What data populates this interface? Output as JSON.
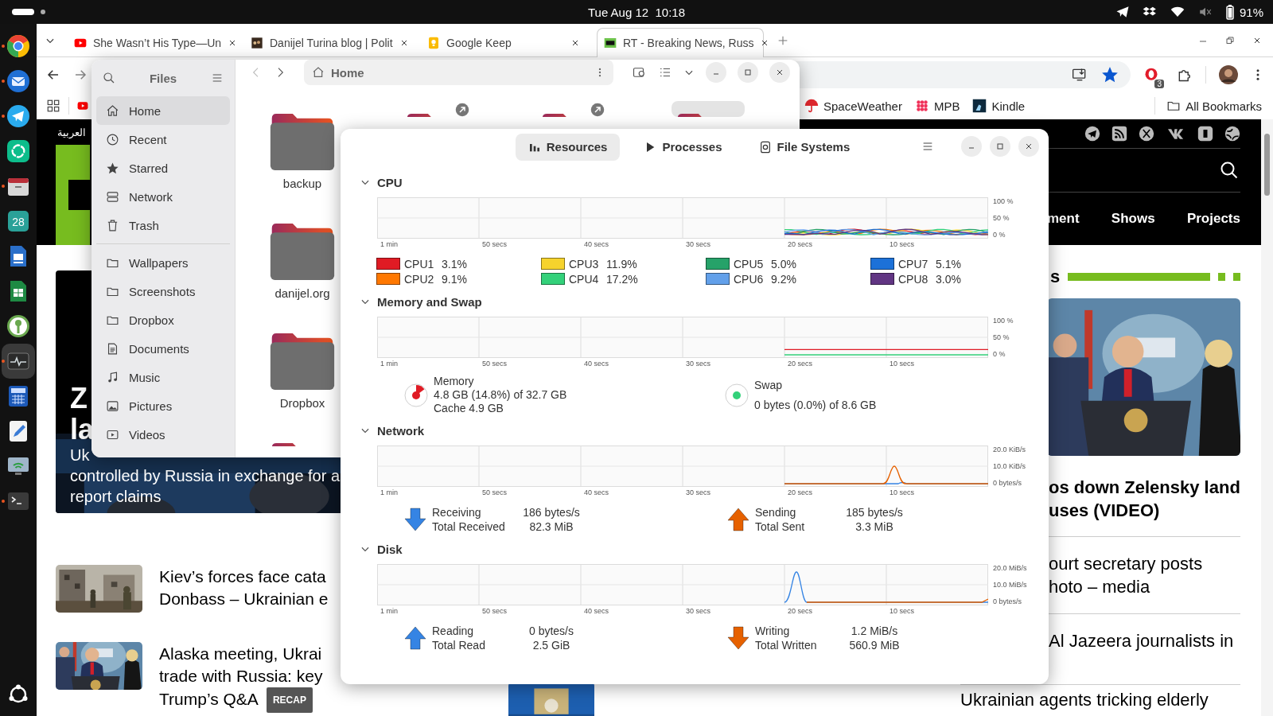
{
  "top_bar": {
    "clock": "Tue Aug 12  10:18",
    "battery": "91%"
  },
  "dock": [
    {
      "kind": "chrome",
      "running": true,
      "selected": false
    },
    {
      "kind": "thunderbird",
      "running": true,
      "selected": false
    },
    {
      "kind": "telegram",
      "running": true,
      "selected": false
    },
    {
      "kind": "element",
      "running": false,
      "selected": false
    },
    {
      "kind": "files",
      "running": true,
      "selected": false
    },
    {
      "kind": "calendar",
      "label": "28",
      "running": false,
      "selected": false
    },
    {
      "kind": "writer",
      "running": false,
      "selected": false
    },
    {
      "kind": "spreadsheet",
      "running": false,
      "selected": false
    },
    {
      "kind": "keepass",
      "running": false,
      "selected": false
    },
    {
      "kind": "monitor",
      "running": true,
      "selected": true
    },
    {
      "kind": "calculator",
      "running": false,
      "selected": false
    },
    {
      "kind": "editor",
      "running": false,
      "selected": false
    },
    {
      "kind": "remote",
      "running": false,
      "selected": false
    },
    {
      "kind": "terminal",
      "running": true,
      "selected": false
    }
  ],
  "browser": {
    "tabs": [
      {
        "title": "She Wasn’t His Type—Un",
        "selected": false
      },
      {
        "title": "Danijel Turina blog | Polit",
        "selected": false
      },
      {
        "title": "Google Keep",
        "selected": false
      },
      {
        "title": "RT - Breaking News, Russ",
        "selected": true
      }
    ],
    "bookmarked": true,
    "extension_badge": "3",
    "bookmarks": [
      {
        "label": "SpaceWeather"
      },
      {
        "label": "MPB"
      },
      {
        "label": "Kindle"
      }
    ],
    "all_bookmarks": "All Bookmarks",
    "page": {
      "language": "العربية",
      "nav": [
        "ment",
        "Shows",
        "Projects"
      ],
      "hero": {
        "title_lines": [
          "Z",
          "la"
        ],
        "text_lines": [
          "Uk",
          "controlled by Russia in exchange for a",
          "report claims"
        ]
      },
      "headlines": [
        {
          "lines": [
            "Kiev’s forces face cata",
            "Donbass – Ukrainian e"
          ]
        },
        {
          "lines": [
            "Alaska meeting, Ukrai",
            "trade with Russia: key",
            "Trump’s Q&A"
          ],
          "badge": "RECAP"
        }
      ],
      "section_title": "s",
      "lead": [
        "os down Zelensky land",
        "uses (VIDEO)"
      ],
      "stories": [
        {
          "lines": [
            "ourt secretary posts",
            "hoto – media"
          ]
        },
        {
          "lines": [
            "Al Jazeera journalists in"
          ]
        },
        {
          "lines": [
            "Ukrainian agents tricking elderly"
          ]
        }
      ]
    }
  },
  "files": {
    "title": "Files",
    "places": [
      {
        "label": "Home",
        "selected": true
      },
      {
        "label": "Recent",
        "selected": false
      },
      {
        "label": "Starred",
        "selected": false
      },
      {
        "label": "Network",
        "selected": false
      },
      {
        "label": "Trash",
        "selected": false
      }
    ],
    "bookmarks": [
      {
        "label": "Wallpapers",
        "selected": false
      },
      {
        "label": "Screenshots",
        "selected": false
      },
      {
        "label": "Dropbox",
        "selected": false
      },
      {
        "label": "Documents",
        "selected": false
      },
      {
        "label": "Music",
        "selected": false
      },
      {
        "label": "Pictures",
        "selected": false
      },
      {
        "label": "Videos",
        "selected": false
      }
    ],
    "path": "Home",
    "folders": [
      {
        "name": "backup",
        "selected": false,
        "shared": false
      },
      {
        "selected": false,
        "shared": true
      },
      {
        "selected": false,
        "shared": true
      },
      {
        "selected": true,
        "shared": false
      },
      {
        "name": "danijel.org",
        "selected": false,
        "shared": false
      },
      {
        "name": "Dropbox",
        "selected": false,
        "shared": false
      },
      {
        "selected": false,
        "shared": false
      }
    ]
  },
  "system_monitor": {
    "tabs": [
      {
        "label": "Resources",
        "selected": true
      },
      {
        "label": "Processes",
        "selected": false
      },
      {
        "label": "File Systems",
        "selected": false
      }
    ],
    "sections": [
      {
        "kind": "cpu",
        "title": "CPU",
        "expanded": true,
        "x_labels": [
          "1 min",
          "50 secs",
          "40 secs",
          "30 secs",
          "20 secs",
          "10 secs"
        ],
        "y_labels": [
          "100 %",
          "50 %",
          "0 %"
        ],
        "legend": [
          {
            "name": "CPU1",
            "reading": "3.1%",
            "color": "#e01b24"
          },
          {
            "name": "CPU2",
            "reading": "9.1%",
            "color": "#ff7800"
          },
          {
            "name": "CPU3",
            "reading": "11.9%",
            "color": "#f6d32d"
          },
          {
            "name": "CPU4",
            "reading": "17.2%",
            "color": "#33d17a"
          },
          {
            "name": "CPU5",
            "reading": "5.0%",
            "color": "#26a269"
          },
          {
            "name": "CPU6",
            "reading": "9.2%",
            "color": "#62a0ea"
          },
          {
            "name": "CPU7",
            "reading": "5.1%",
            "color": "#1c71d8"
          },
          {
            "name": "CPU8",
            "reading": "3.0%",
            "color": "#613583"
          }
        ]
      },
      {
        "kind": "memory",
        "title": "Memory and Swap",
        "expanded": true,
        "x_labels": [
          "1 min",
          "50 secs",
          "40 secs",
          "30 secs",
          "20 secs",
          "10 secs"
        ],
        "y_labels": [
          "100 %",
          "50 %",
          "0 %"
        ],
        "gauges": [
          {
            "label": "Memory",
            "lines": [
              "4.8 GB (14.8%) of 32.7 GB",
              "Cache 4.9 GB"
            ],
            "level": 0.15,
            "color": "#e01b24"
          },
          {
            "label": "Swap",
            "lines": [
              "0 bytes (0.0%) of 8.6 GB"
            ],
            "color": "#33d17a"
          }
        ]
      },
      {
        "kind": "network",
        "title": "Network",
        "expanded": true,
        "x_labels": [
          "1 min",
          "50 secs",
          "40 secs",
          "30 secs",
          "20 secs",
          "10 secs"
        ],
        "y_labels": [
          "20.0 KiB/s",
          "10.0 KiB/s",
          "0 bytes/s"
        ],
        "stats": [
          {
            "kind": "down",
            "color": "#3584e4",
            "rows": [
              {
                "label": "Receiving",
                "value": "186 bytes/s"
              },
              {
                "label": "Total Received",
                "value": "82.3 MiB"
              }
            ]
          },
          {
            "kind": "up",
            "color": "#e66100",
            "rows": [
              {
                "label": "Sending",
                "value": "185 bytes/s"
              },
              {
                "label": "Total Sent",
                "value": "3.3 MiB"
              }
            ]
          }
        ]
      },
      {
        "kind": "disk",
        "title": "Disk",
        "expanded": true,
        "x_labels": [
          "1 min",
          "50 secs",
          "40 secs",
          "30 secs",
          "20 secs",
          "10 secs"
        ],
        "y_labels": [
          "20.0 MiB/s",
          "10.0 MiB/s",
          "0 bytes/s"
        ],
        "stats": [
          {
            "kind": "up",
            "color": "#3584e4",
            "rows": [
              {
                "label": "Reading",
                "value": "0 bytes/s"
              },
              {
                "label": "Total Read",
                "value": "2.5 GiB"
              }
            ]
          },
          {
            "kind": "down",
            "color": "#e66100",
            "rows": [
              {
                "label": "Writing",
                "value": "1.2 MiB/s"
              },
              {
                "label": "Total Written",
                "value": "560.9 MiB"
              }
            ]
          }
        ]
      }
    ]
  }
}
